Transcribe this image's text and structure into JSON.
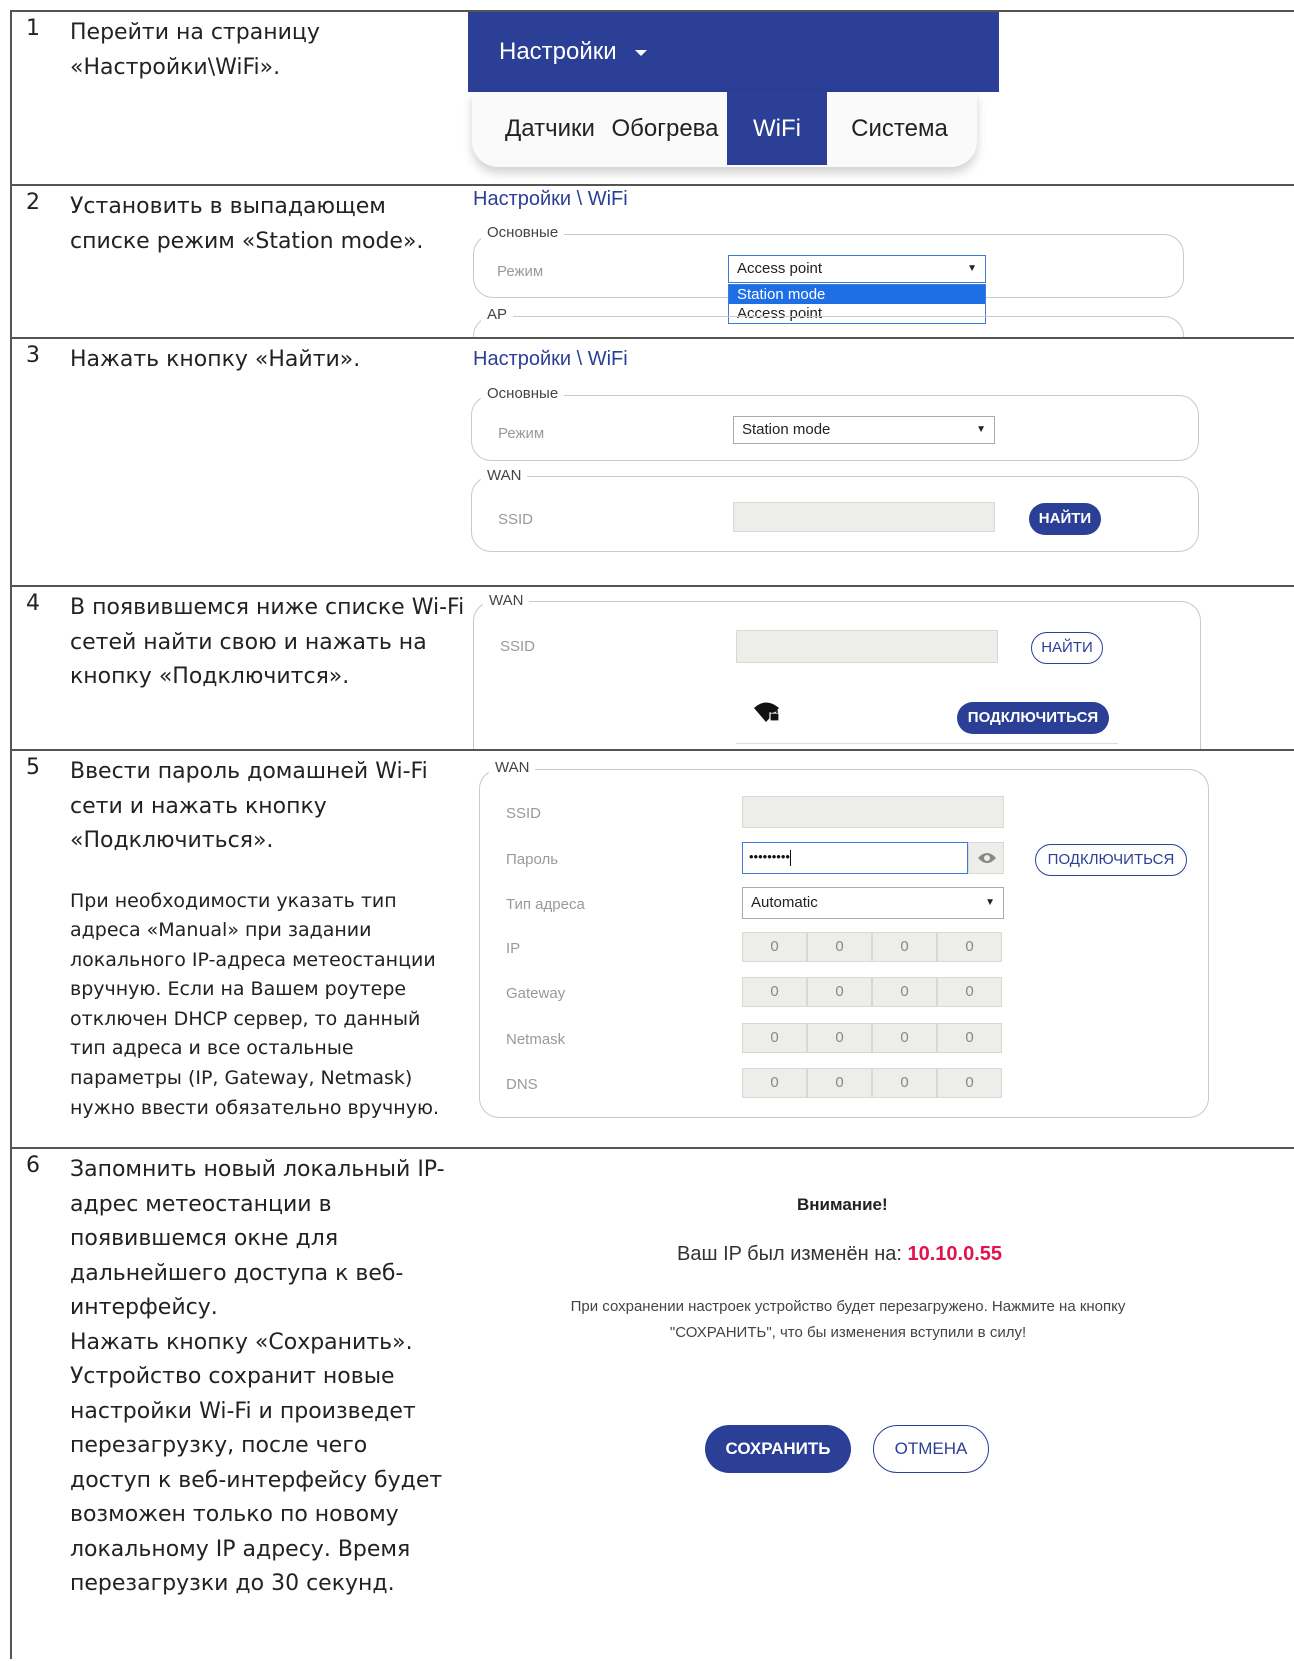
{
  "rows": [
    {
      "num": "1",
      "text": [
        "Перейти на страницу «Настройки\\WiFi»."
      ],
      "menu": {
        "title": "Настройки",
        "tabs": [
          "Датчики",
          "Обогрева",
          "WiFi",
          "Система"
        ],
        "active_tab": "WiFi"
      }
    },
    {
      "num": "2",
      "text": [
        "Установить в выпадающем списке режим  «Station mode»."
      ],
      "breadcrumb": "Настройки \\ WiFi",
      "legend_main": "Основные",
      "mode_label": "Режим",
      "mode_value": "Access point",
      "options": [
        "Station mode",
        "Access point"
      ],
      "highlighted_option": "Station mode",
      "legend_ap": "AP"
    },
    {
      "num": "3",
      "text": [
        "Нажать кнопку «Найти»."
      ],
      "breadcrumb": "Настройки \\ WiFi",
      "legend_main": "Основные",
      "mode_label": "Режим",
      "mode_value": "Station mode",
      "legend_wan": "WAN",
      "ssid_label": "SSID",
      "find_button": "НАЙТИ"
    },
    {
      "num": "4",
      "text": [
        "В появившемся ниже списке Wi-Fi сетей найти свою и нажать на кнопку «Подключится»."
      ],
      "legend_wan": "WAN",
      "ssid_label": "SSID",
      "find_button": "НАЙТИ",
      "wifi_icon": "wifi-lock-icon",
      "connect_button": "ПОДКЛЮЧИТЬСЯ"
    },
    {
      "num": "5",
      "text": [
        "Ввести пароль домашней Wi-Fi сети и нажать кнопку «Подключиться».",
        "При необходимости указать тип адреса «Manual» при задании локального IP-адреса метеостанции вручную. Если на Вашем роутере отключен DHCP сервер, то данный тип адреса и все остальные параметры (IP, Gateway, Netmask) нужно ввести обязательно вручную."
      ],
      "legend_wan": "WAN",
      "ssid_label": "SSID",
      "password_label": "Пароль",
      "password_value": "•••••••••",
      "connect_button": "ПОДКЛЮЧИТЬСЯ",
      "address_type_label": "Тип адреса",
      "address_type_value": "Automatic",
      "ip_fields": [
        {
          "label": "IP",
          "octets": [
            "0",
            "0",
            "0",
            "0"
          ]
        },
        {
          "label": "Gateway",
          "octets": [
            "0",
            "0",
            "0",
            "0"
          ]
        },
        {
          "label": "Netmask",
          "octets": [
            "0",
            "0",
            "0",
            "0"
          ]
        },
        {
          "label": "DNS",
          "octets": [
            "0",
            "0",
            "0",
            "0"
          ]
        }
      ]
    },
    {
      "num": "6",
      "text": [
        "Запомнить новый локальный IP-адрес метеостанции в появившемся окне для дальнейшего доступа к веб-интерфейсу.",
        "Нажать кнопку «Сохранить». Устройство сохранит новые настройки Wi-Fi и произведет перезагрузку, после чего доступ к веб-интерфейсу будет возможен только по новому локальному IP адресу. Время перезагрузки до 30 секунд."
      ],
      "dialog": {
        "title": "Внимание!",
        "ip_prefix": "Ваш IP был изменён на:",
        "ip_value": "10.10.0.55",
        "note": "При сохранении настроек устройство будет перезагружено. Нажмите на кнопку \"СОХРАНИТЬ\", что бы изменения вступили в силу!",
        "save_button": "СОХРАНИТЬ",
        "cancel_button": "ОТМЕНА"
      }
    }
  ],
  "colors": {
    "brand_blue": "#2a3f95",
    "ip_red": "#e0134f",
    "select_highlight": "#1e6fe6"
  }
}
